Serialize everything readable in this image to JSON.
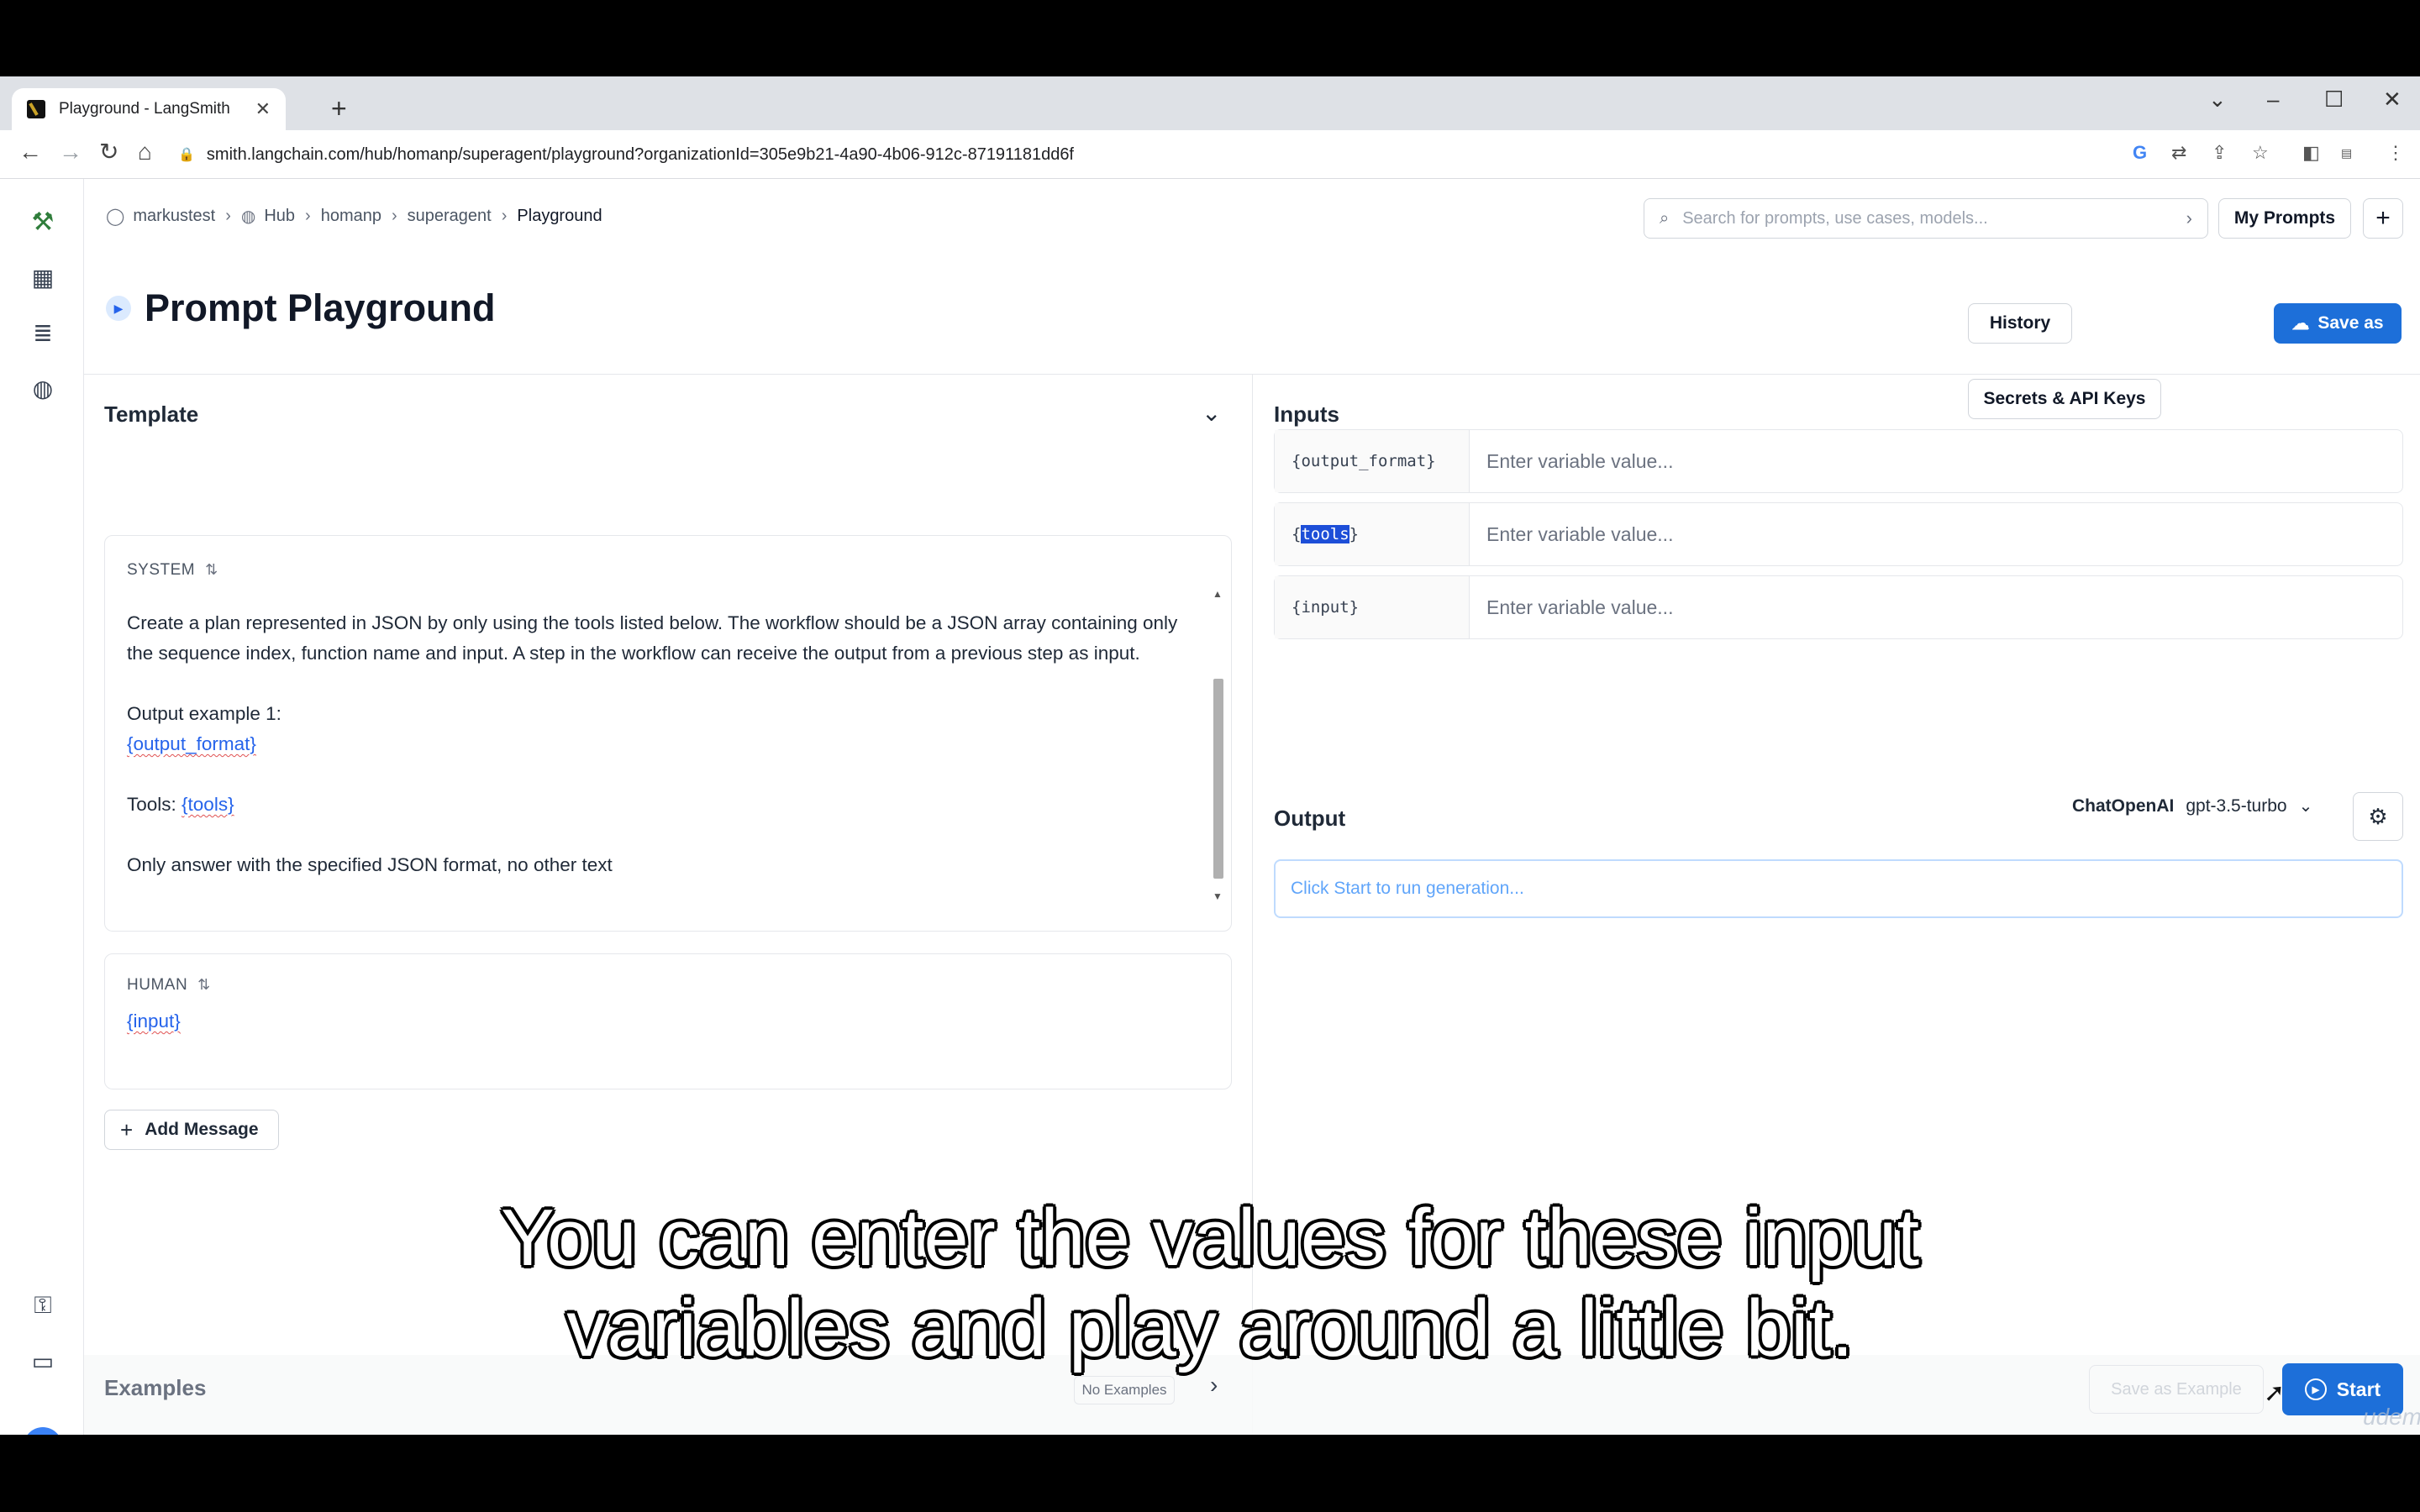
{
  "browser": {
    "tab_title": "Playground - LangSmith",
    "url": "smith.langchain.com/hub/homanp/superagent/playground?organizationId=305e9b21-4a90-4b06-912c-87191181dd6f"
  },
  "breadcrumb": {
    "items": [
      "markustest",
      "Hub",
      "homanp",
      "superagent"
    ],
    "current": "Playground"
  },
  "header": {
    "search_placeholder": "Search for prompts, use cases, models...",
    "my_prompts": "My Prompts",
    "new_label": "+"
  },
  "page": {
    "title": "Prompt Playground",
    "secrets_button": "Secrets & API Keys",
    "history_button": "History",
    "save_as_button": "Save as"
  },
  "template": {
    "title": "Template",
    "system": {
      "role": "SYSTEM",
      "para1": "Create a plan represented in JSON by only using the tools listed below. The workflow should be a JSON array containing only the sequence index, function name and input. A step in the workflow can receive the output from a previous step as input.",
      "line_output": "Output example 1:",
      "var_output": "{output_format}",
      "line_tools": "Tools: ",
      "var_tools": "{tools}",
      "line_only": "Only answer with the specified JSON format, no other text"
    },
    "human": {
      "role": "HUMAN",
      "var_input": "{input}"
    },
    "add_message": "Add Message"
  },
  "inputs": {
    "title": "Inputs",
    "rows": [
      {
        "name": "{output_format}",
        "placeholder": "Enter variable value..."
      },
      {
        "name_open": "{",
        "name_hl": "tools",
        "name_close": "}",
        "placeholder": "Enter variable value..."
      },
      {
        "name": "{input}",
        "placeholder": "Enter variable value..."
      }
    ]
  },
  "output": {
    "title": "Output",
    "provider": "ChatOpenAI",
    "model": "gpt-3.5-turbo",
    "placeholder": "Click Start to run generation..."
  },
  "examples": {
    "title": "Examples",
    "badge": "No Examples",
    "save_example": "Save as Example",
    "start": "Start"
  },
  "subtitle": {
    "line1": "You can enter the values for these input",
    "line2": "variables and play around a little bit."
  },
  "watermark": "udemy"
}
